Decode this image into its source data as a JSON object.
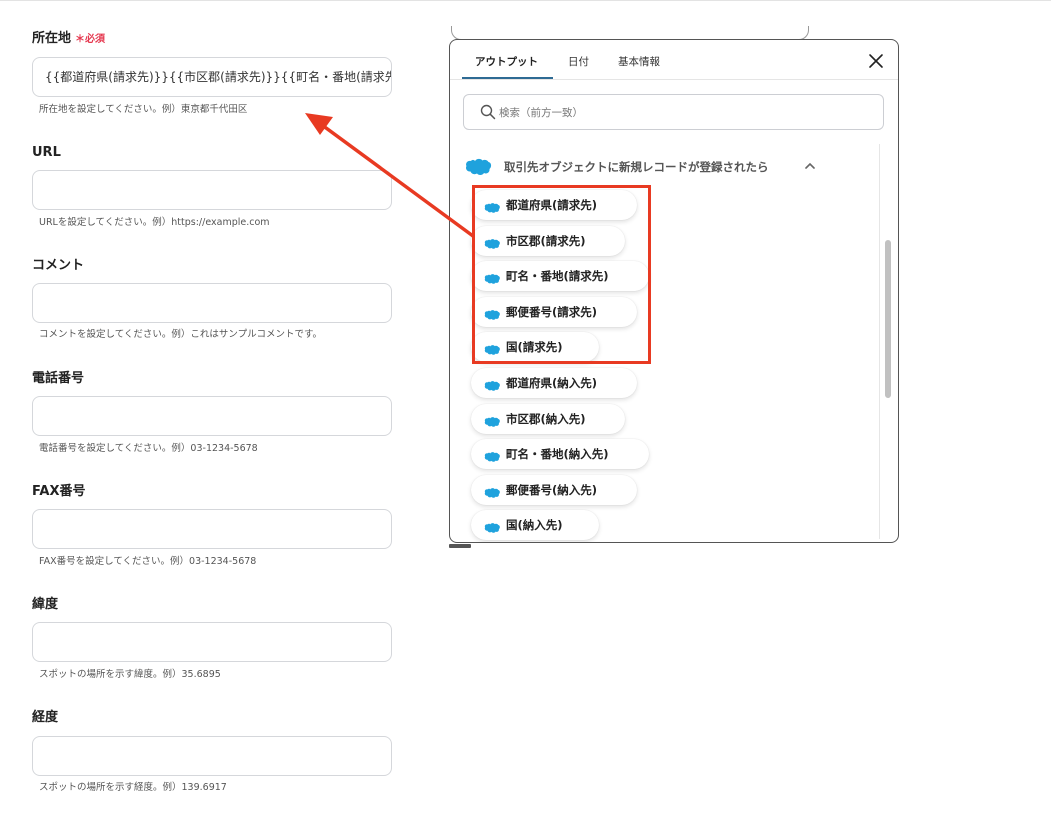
{
  "form": {
    "fields": [
      {
        "label": "所在地",
        "required_label": "＊必須",
        "value": "{{都道府県(請求先)}}{{市区郡(請求先)}}{{町名・番地(請求先)}}",
        "hint": "所在地を設定してください。例）東京都千代田区"
      },
      {
        "label": "URL",
        "value": "",
        "hint": "URLを設定してください。例）https://example.com"
      },
      {
        "label": "コメント",
        "value": "",
        "hint": "コメントを設定してください。例）これはサンプルコメントです。"
      },
      {
        "label": "電話番号",
        "value": "",
        "hint": "電話番号を設定してください。例）03-1234-5678"
      },
      {
        "label": "FAX番号",
        "value": "",
        "hint": "FAX番号を設定してください。例）03-1234-5678"
      },
      {
        "label": "緯度",
        "value": "",
        "hint": "スポットの場所を示す緯度。例）35.6895"
      },
      {
        "label": "経度",
        "value": "",
        "hint": "スポットの場所を示す経度。例）139.6917"
      }
    ]
  },
  "panel": {
    "tabs": [
      {
        "label": "アウトプット",
        "active": true
      },
      {
        "label": "日付",
        "active": false
      },
      {
        "label": "基本情報",
        "active": false
      }
    ],
    "close_icon": "close-icon",
    "search_placeholder": "検索（前方一致）",
    "group_title": "取引先オブジェクトに新規レコードが登録されたら",
    "items": [
      "都道府県(請求先)",
      "市区郡(請求先)",
      "町名・番地(請求先)",
      "郵便番号(請求先)",
      "国(請求先)",
      "都道府県(納入先)",
      "市区郡(納入先)",
      "町名・番地(納入先)",
      "郵便番号(納入先)",
      "国(納入先)"
    ]
  },
  "colors": {
    "required": "#e53950",
    "salesforce_blue": "#1fa2dd",
    "highlight": "#e83a22",
    "tab_underline": "#2e6b94"
  }
}
